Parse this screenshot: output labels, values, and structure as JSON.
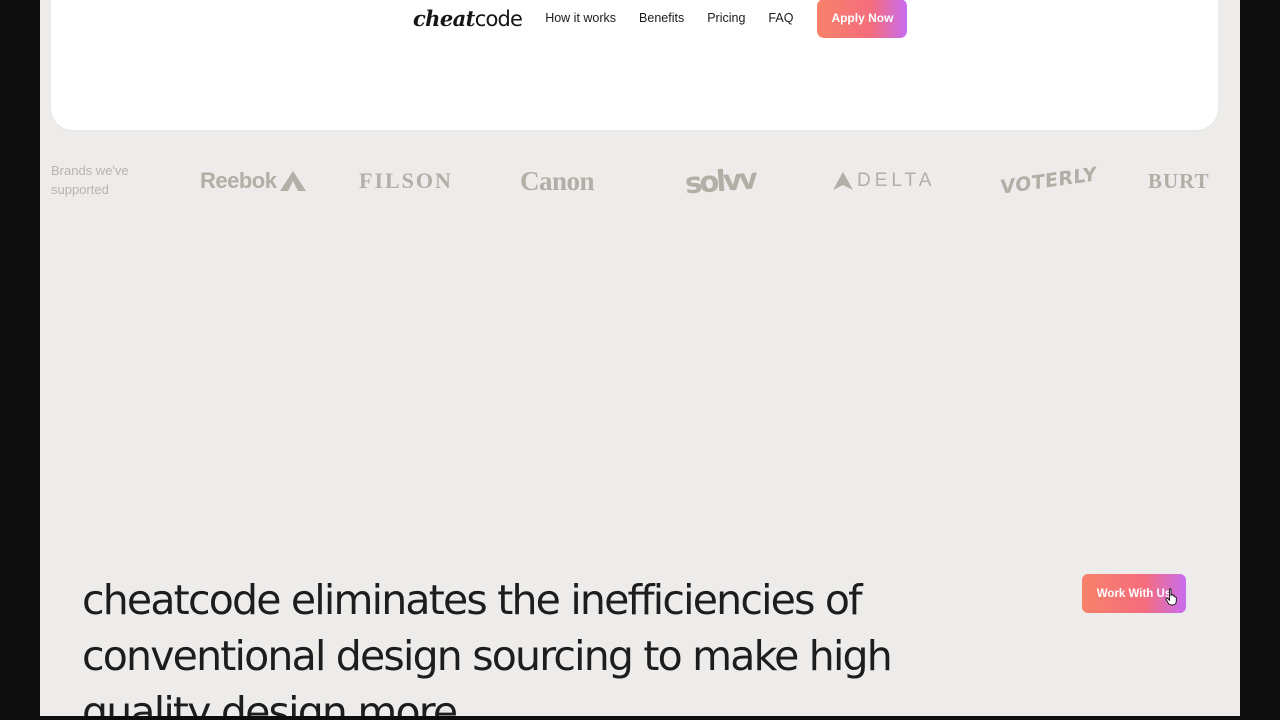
{
  "header": {
    "logo": {
      "part1": "cheat",
      "part2": "code"
    },
    "nav_links": [
      "How it works",
      "Benefits",
      "Pricing",
      "FAQ"
    ],
    "cta_label": "Apply Now"
  },
  "brands": {
    "label": "Brands we've supported",
    "names": [
      "Reebok",
      "FILSON",
      "Canon",
      "solvv",
      "DELTA",
      "VOTERLY",
      "BURT"
    ]
  },
  "hero": {
    "text": "cheatcode eliminates the inefficiencies of conventional design sourcing to make high quality design more"
  },
  "work_button_label": "Work With Us",
  "colors": {
    "accent_start": "#f7826a",
    "accent_mid": "#f56d7d",
    "accent_end": "#c86df0",
    "page_bg": "#edecea",
    "brand_grey": "#b3aea6"
  }
}
